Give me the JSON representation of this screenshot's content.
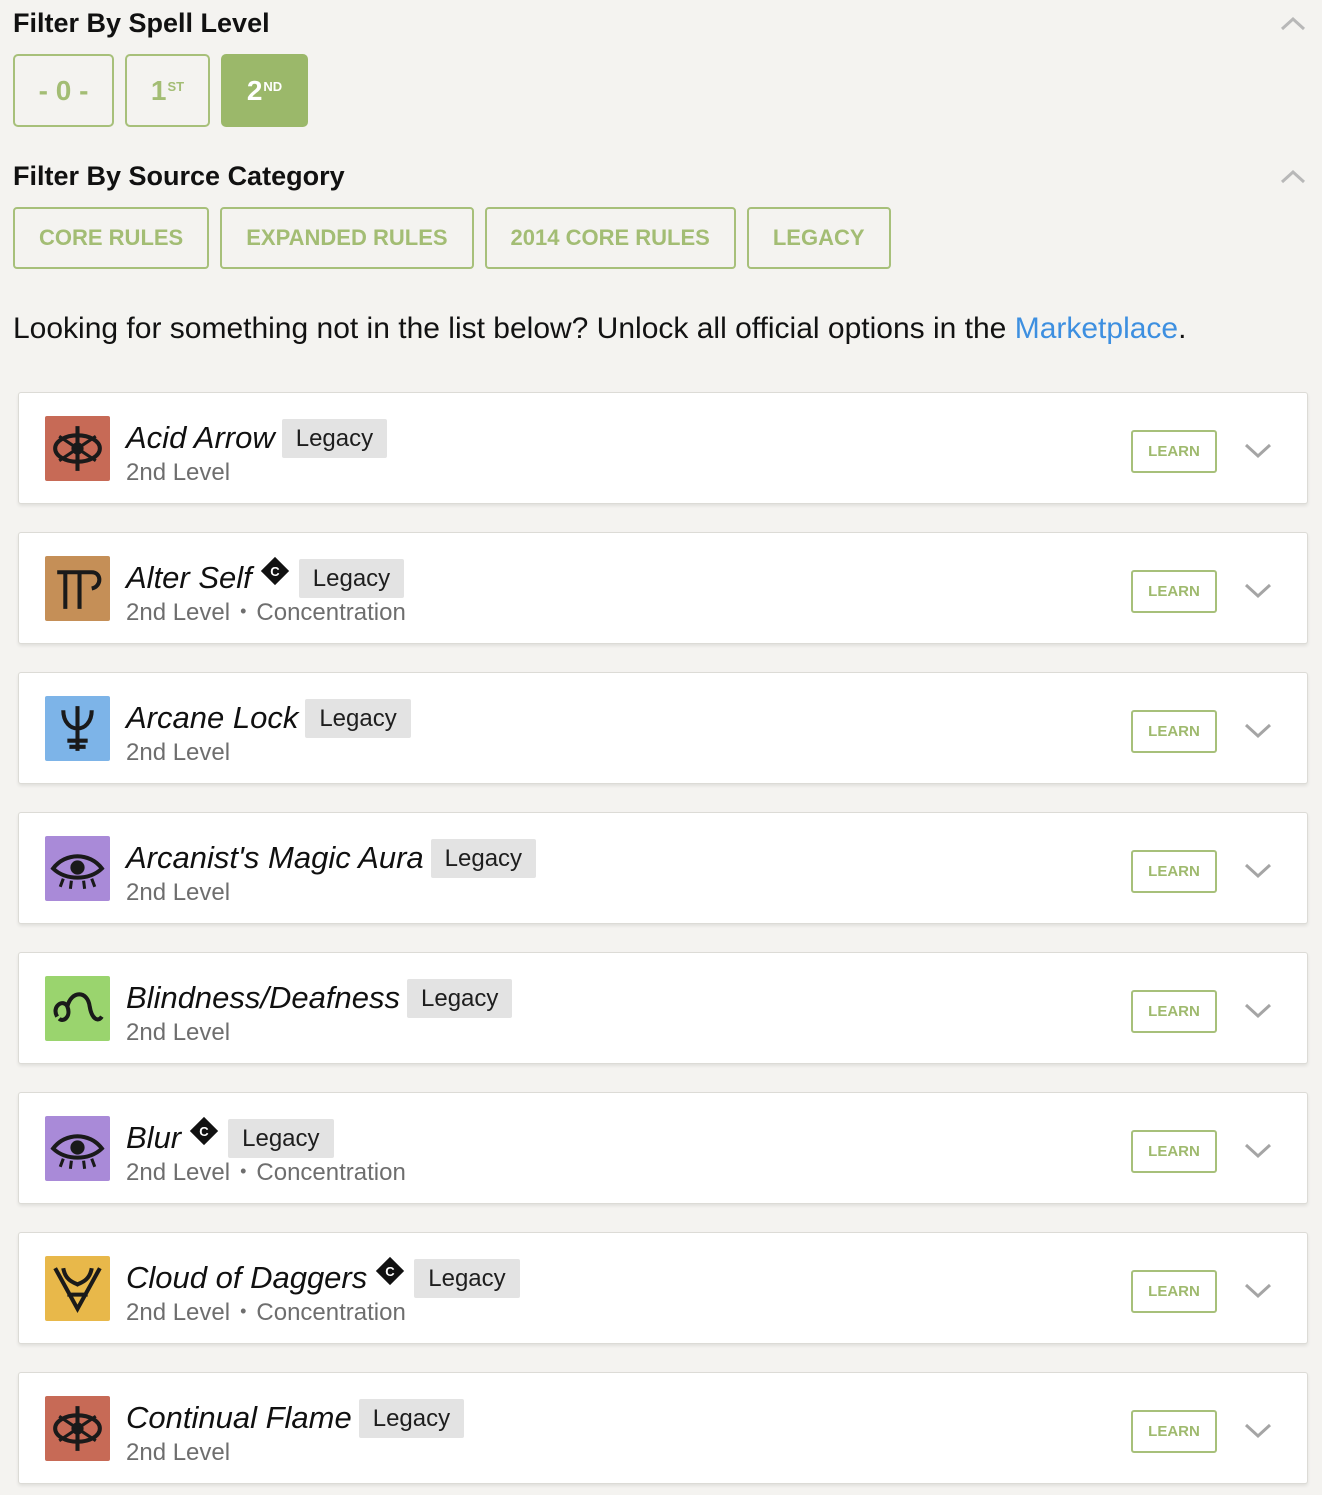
{
  "spell_level_filter": {
    "title": "Filter By Spell Level",
    "levels": [
      {
        "main": "- 0 -",
        "sup": "",
        "active": false
      },
      {
        "main": "1",
        "sup": "ST",
        "active": false
      },
      {
        "main": "2",
        "sup": "ND",
        "active": true
      }
    ]
  },
  "source_filter": {
    "title": "Filter By Source Category",
    "categories": [
      "CORE RULES",
      "EXPANDED RULES",
      "2014 CORE RULES",
      "LEGACY"
    ]
  },
  "marketplace_notice": {
    "text": "Looking for something not in the list below? Unlock all official options in the ",
    "link": "Marketplace",
    "end": "."
  },
  "colors": {
    "accent_green": "#9bb86a",
    "link_blue": "#3d8fe0"
  },
  "spells": [
    {
      "name": "Acid Arrow",
      "tag": "Legacy",
      "level": "2nd Level",
      "concentration": false,
      "conc_badge": "C",
      "extra": "",
      "learn": "LEARN",
      "icon": "evocation-school-icon",
      "icon_color": "#c76a56"
    },
    {
      "name": "Alter Self",
      "tag": "Legacy",
      "level": "2nd Level",
      "concentration": true,
      "conc_badge": "C",
      "extra": "Concentration",
      "learn": "LEARN",
      "icon": "transmutation-school-icon",
      "icon_color": "#c58f57"
    },
    {
      "name": "Arcane Lock",
      "tag": "Legacy",
      "level": "2nd Level",
      "concentration": false,
      "conc_badge": "C",
      "extra": "",
      "learn": "LEARN",
      "icon": "abjuration-school-icon",
      "icon_color": "#7db4e8"
    },
    {
      "name": "Arcanist's Magic Aura",
      "tag": "Legacy",
      "level": "2nd Level",
      "concentration": false,
      "conc_badge": "C",
      "extra": "",
      "learn": "LEARN",
      "icon": "illusion-school-icon",
      "icon_color": "#a98ad8"
    },
    {
      "name": "Blindness/Deafness",
      "tag": "Legacy",
      "level": "2nd Level",
      "concentration": false,
      "conc_badge": "C",
      "extra": "",
      "learn": "LEARN",
      "icon": "necromancy-school-icon",
      "icon_color": "#9ad46e"
    },
    {
      "name": "Blur",
      "tag": "Legacy",
      "level": "2nd Level",
      "concentration": true,
      "conc_badge": "C",
      "extra": "Concentration",
      "learn": "LEARN",
      "icon": "illusion-school-icon",
      "icon_color": "#a98ad8"
    },
    {
      "name": "Cloud of Daggers",
      "tag": "Legacy",
      "level": "2nd Level",
      "concentration": true,
      "conc_badge": "C",
      "extra": "Concentration",
      "learn": "LEARN",
      "icon": "conjuration-school-icon",
      "icon_color": "#e8b84a"
    },
    {
      "name": "Continual Flame",
      "tag": "Legacy",
      "level": "2nd Level",
      "concentration": false,
      "conc_badge": "C",
      "extra": "",
      "learn": "LEARN",
      "icon": "evocation-school-icon",
      "icon_color": "#c76a56"
    }
  ]
}
